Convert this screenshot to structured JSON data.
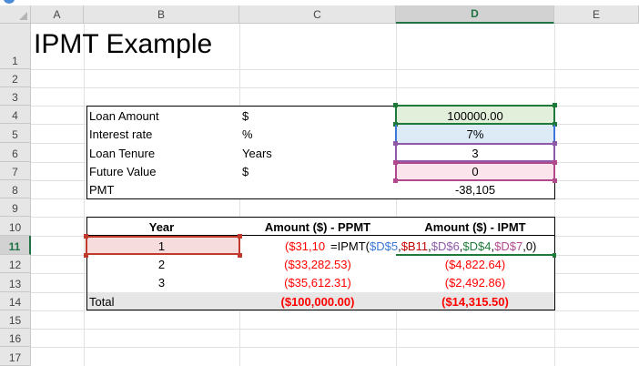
{
  "columns": [
    "A",
    "B",
    "C",
    "D",
    "E"
  ],
  "rows": [
    "1",
    "2",
    "3",
    "4",
    "5",
    "6",
    "7",
    "8",
    "9",
    "10",
    "11",
    "12",
    "13",
    "14",
    "15",
    "16",
    "17"
  ],
  "title": "IPMT Example",
  "inputs": [
    {
      "label": "Loan Amount",
      "unit": "$",
      "value": "100000.00"
    },
    {
      "label": "Interest rate",
      "unit": "%",
      "value": "7%"
    },
    {
      "label": "Loan Tenure",
      "unit": "Years",
      "value": "3"
    },
    {
      "label": "Future Value",
      "unit": "$",
      "value": "0"
    },
    {
      "label": "PMT",
      "unit": "",
      "value": "-38,105"
    }
  ],
  "table": {
    "headers": [
      "Year",
      "Amount ($) - PPMT",
      "Amount ($) - IPMT"
    ],
    "rows": [
      {
        "year": "1",
        "ppmt": "($31,10"
      },
      {
        "year": "2",
        "ppmt": "($33,282.53)",
        "ipmt": "($4,822.64)"
      },
      {
        "year": "3",
        "ppmt": "($35,612.31)",
        "ipmt": "($2,492.86)"
      }
    ],
    "total": {
      "label": "Total",
      "ppmt": "($100,000.00)",
      "ipmt": "($14,315.50)"
    }
  },
  "formula": {
    "p1": "=IPMT(",
    "p2": "$D$5",
    "p3": ",",
    "p4": "$B11",
    "p5": ",",
    "p6": "$D$6",
    "p7": ",",
    "p8": "$D$4",
    "p9": ",",
    "p10": "$D$7",
    "p11": ",0)"
  },
  "colors": {
    "selected_header": "#217346",
    "negative": "#ff0000",
    "total_fill": "#e6e6e6"
  }
}
